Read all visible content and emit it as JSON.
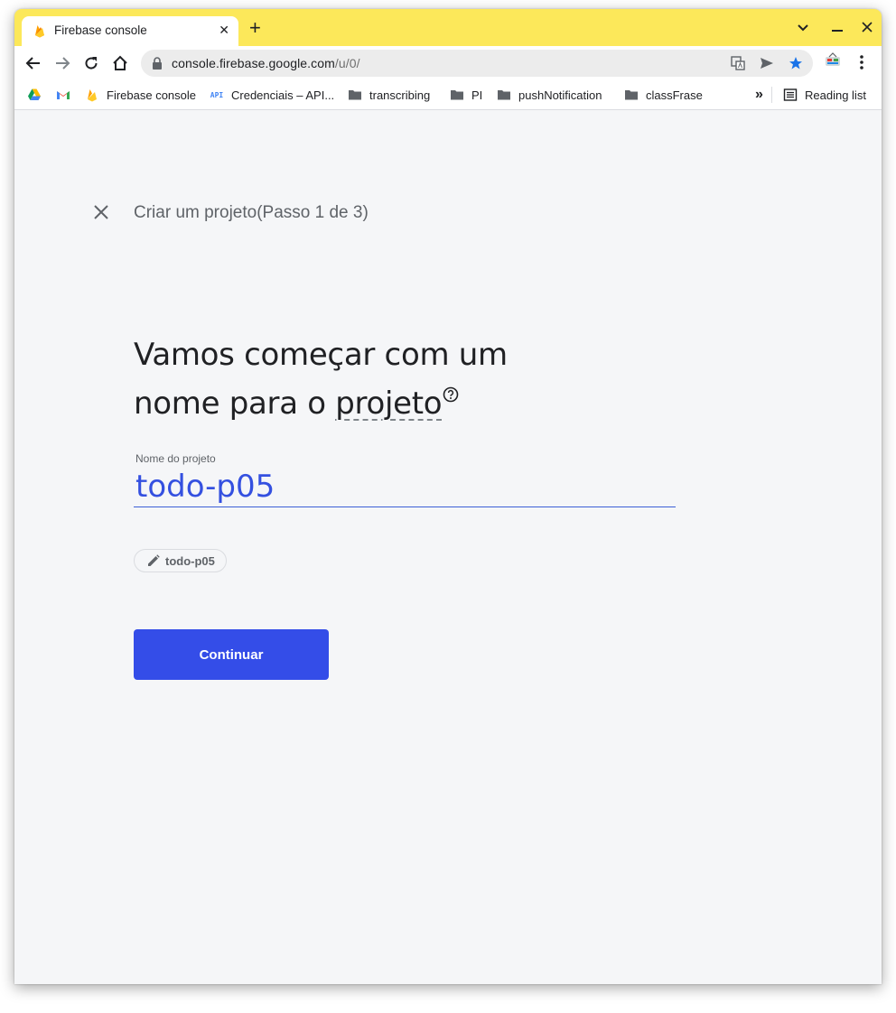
{
  "browser": {
    "tab": {
      "title": "Firebase console"
    },
    "address_bar": {
      "host": "console.firebase.google.com",
      "path": "/u/0/"
    },
    "bookmarks": [
      {
        "label": "",
        "icon": "google-drive-icon"
      },
      {
        "label": "",
        "icon": "gmail-icon"
      },
      {
        "label": "Firebase console",
        "icon": "firebase-icon"
      },
      {
        "label": "Credenciais – API...",
        "icon": "api-icon"
      },
      {
        "label": "transcribing",
        "icon": "folder-icon"
      },
      {
        "label": "PI",
        "icon": "folder-icon"
      },
      {
        "label": "pushNotification",
        "icon": "folder-icon"
      },
      {
        "label": "classFrase",
        "icon": "folder-icon"
      }
    ],
    "api_badge": "API",
    "overflow_label": "»",
    "reading_list": "Reading list",
    "colors": {
      "titlebar": "#fce85a",
      "star": "#1a73e8"
    }
  },
  "page": {
    "step_title": "Criar um projeto(Passo 1 de 3)",
    "heading_line1": "Vamos começar com um",
    "heading_line2_prefix": "nome para o ",
    "heading_line2_link": "projeto",
    "field": {
      "label": "Nome do projeto",
      "value": "todo-p05"
    },
    "project_id_chip": "todo-p05",
    "continue_button": "Continuar",
    "colors": {
      "primary": "#344de8",
      "input_text": "#3450e0"
    }
  }
}
